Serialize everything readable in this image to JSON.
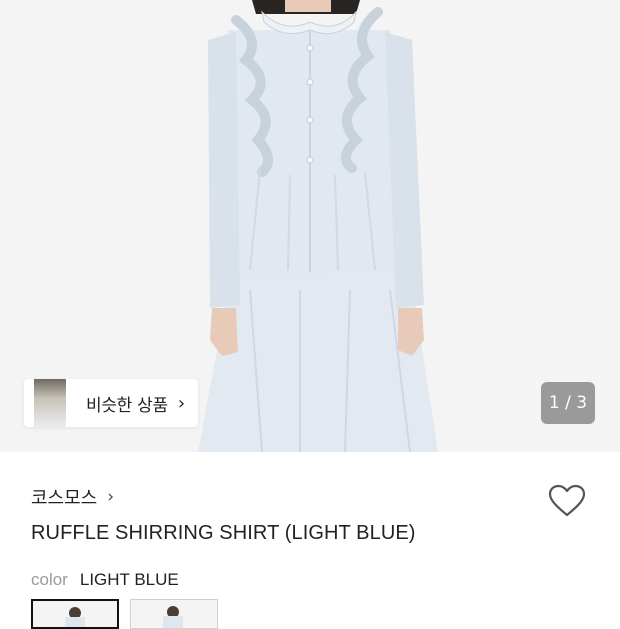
{
  "hero": {
    "similar_chip": {
      "label": "비슷한 상품",
      "chevron": "›",
      "icon": "chevron-right-icon"
    },
    "page_indicator": "1 / 3",
    "colors": {
      "shirt": "#dfe7ef",
      "background": "#f4f4f4",
      "indicator_bg": "#9a9a9a"
    }
  },
  "product": {
    "brand": "코스모스",
    "brand_chevron": "›",
    "title": "RUFFLE SHIRRING SHIRT (LIGHT BLUE)",
    "color_label": "color",
    "color_value": "LIGHT BLUE",
    "wishlist_icon": "heart-outline-icon"
  },
  "swatches": [
    {
      "name": "LIGHT BLUE",
      "selected": true
    },
    {
      "name": "alternate",
      "selected": false
    }
  ]
}
